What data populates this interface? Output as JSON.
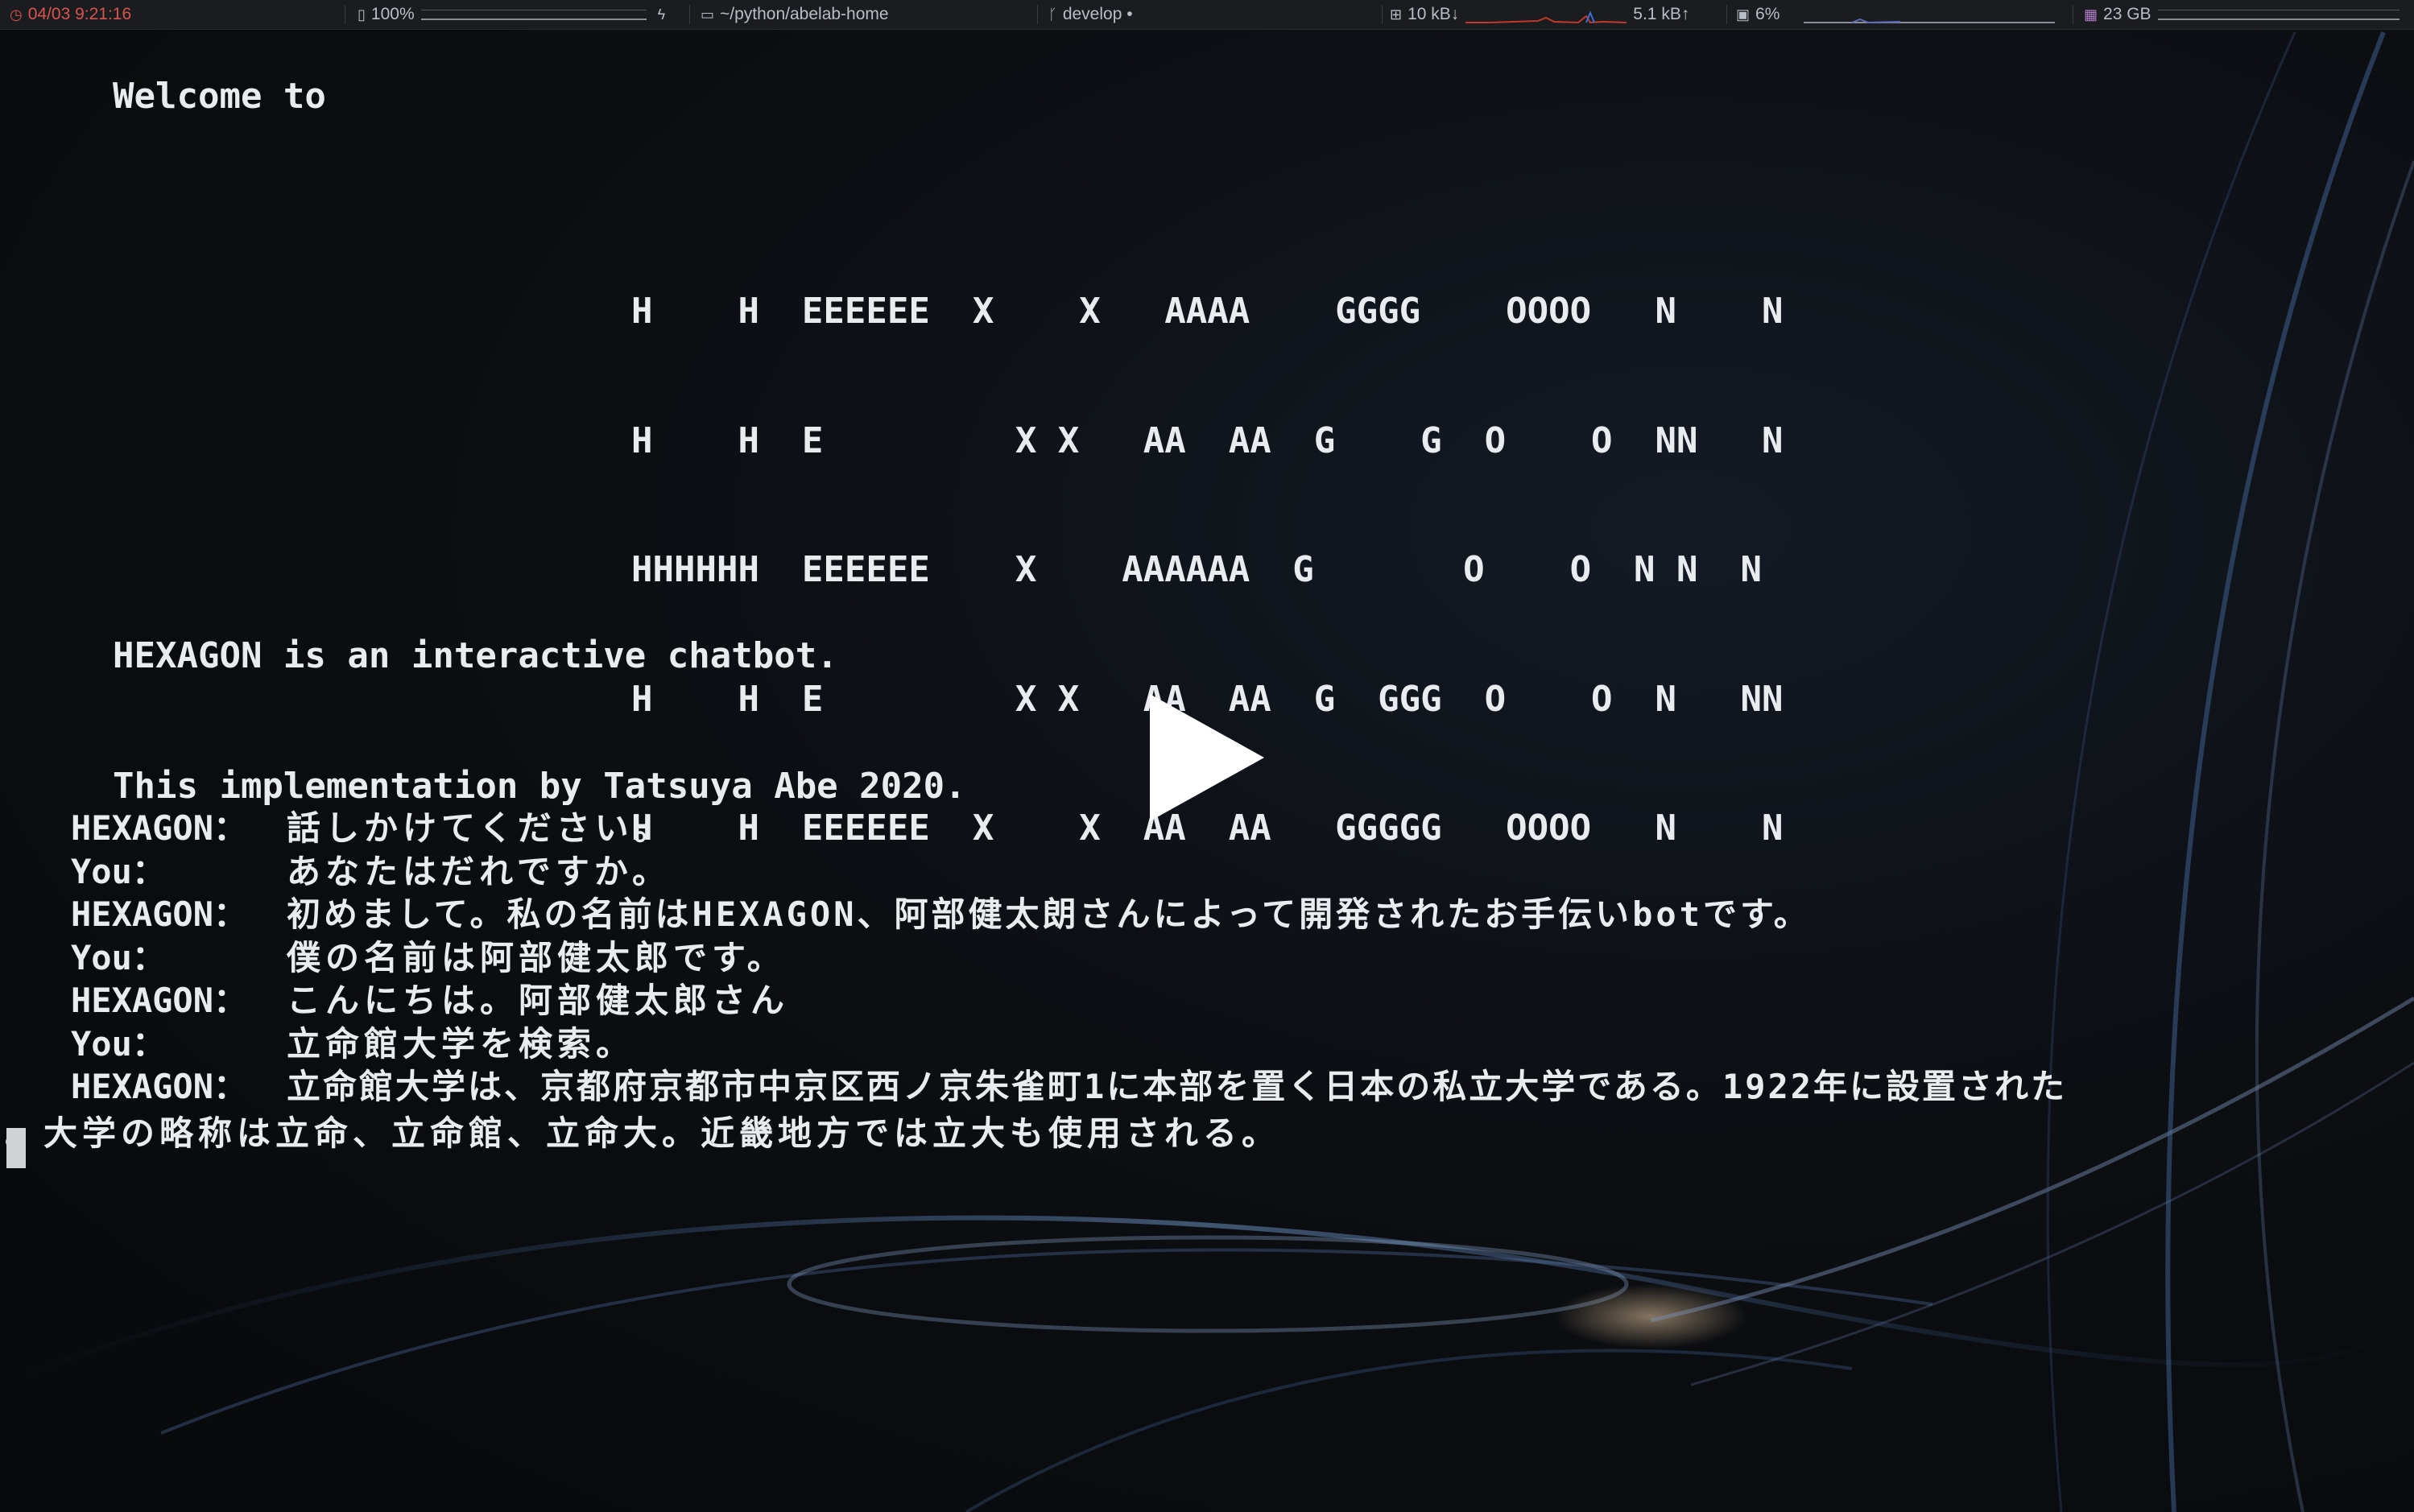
{
  "statusbar": {
    "datetime": "04/03 9:21:16",
    "battery": "100%",
    "path": "~/python/abelab-home",
    "branch": "develop •",
    "net_down": "10 kB↓",
    "net_up": "5.1 kB↑",
    "cpu": "6%",
    "memory": "23 GB",
    "icons": {
      "clock": "clock-icon",
      "battery": "battery-icon",
      "charging": "bolt-icon",
      "folder": "folder-icon",
      "branch": "git-branch-icon",
      "network": "network-icon",
      "cpu": "cpu-icon",
      "memory": "memory-icon"
    },
    "colors": {
      "accent_clock": "#d9534f",
      "net_graph": "#c0392b",
      "cpu_graph": "#5a6ab8",
      "memory_icon": "#b07cc6"
    }
  },
  "terminal": {
    "welcome": "Welcome to",
    "banner": [
      "H    H  EEEEEE  X    X   AAAA    GGGG    OOOO   N    N",
      "H    H  E         X X   AA  AA  G    G  O    O  NN   N",
      "HHHHHH  EEEEEE    X    AAAAAA  G       O    O  N N  N",
      "H    H  E         X X   AA  AA  G  GGG  O    O  N   NN",
      "H    H  EEEEEE  X    X  AA  AA   GGGGG   OOOO   N    N"
    ],
    "intro": [
      "HEXAGON is an interactive chatbot.",
      "This implementation by Tatsuya Abe 2020."
    ],
    "chat": [
      {
        "speaker": "HEXAGON：",
        "text": "話しかけてください。"
      },
      {
        "speaker": "You：",
        "text": "あなたはだれですか。"
      },
      {
        "speaker": "HEXAGON：",
        "text": "初めまして。私の名前はHEXAGON、阿部健太朗さんによって開発されたお手伝いbotです。"
      },
      {
        "speaker": "You：",
        "text": "僕の名前は阿部健太郎です。"
      },
      {
        "speaker": "HEXAGON：",
        "text": "こんにちは。阿部健太郎さん"
      },
      {
        "speaker": "You：",
        "text": "立命館大学を検索。"
      },
      {
        "speaker": "HEXAGON：",
        "text": "立命館大学は、京都府京都市中京区西ノ京朱雀町1に本部を置く日本の私立大学である。1922年に設置された"
      }
    ],
    "wrap_line": "。大学の略称は立命、立命館、立命大。近畿地方では立大も使用される。"
  },
  "overlay": {
    "play_icon": "play-icon"
  }
}
